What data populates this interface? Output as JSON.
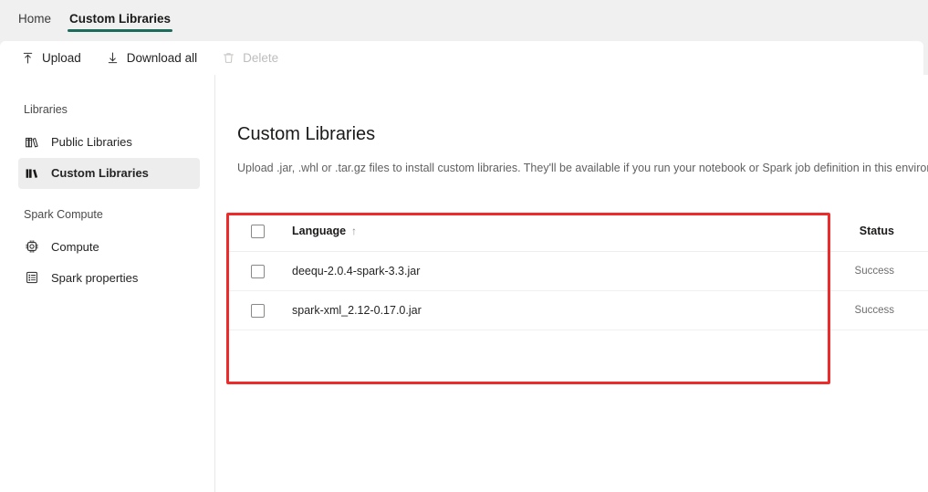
{
  "tabs": [
    {
      "label": "Home",
      "active": false
    },
    {
      "label": "Custom Libraries",
      "active": true
    }
  ],
  "toolbar": {
    "upload_label": "Upload",
    "upload_icon": "upload-arrow-icon",
    "download_all_label": "Download all",
    "download_all_icon": "download-arrow-icon",
    "delete_label": "Delete",
    "delete_icon": "trash-icon",
    "delete_disabled": true
  },
  "sidebar": {
    "groups": [
      {
        "title": "Libraries",
        "items": [
          {
            "label": "Public Libraries",
            "icon": "books-outline-icon",
            "selected": false
          },
          {
            "label": "Custom Libraries",
            "icon": "books-filled-icon",
            "selected": true
          }
        ]
      },
      {
        "title": "Spark Compute",
        "items": [
          {
            "label": "Compute",
            "icon": "cpu-chip-icon",
            "selected": false
          },
          {
            "label": "Spark properties",
            "icon": "list-document-icon",
            "selected": false
          }
        ]
      }
    ]
  },
  "main": {
    "title": "Custom Libraries",
    "description": "Upload .jar, .whl or .tar.gz files to install custom libraries. They'll be available if you run your notebook or Spark job definition in this environmen"
  },
  "table": {
    "select_all_checkbox": "unchecked",
    "columns": {
      "language": "Language",
      "sort_indicator": "↑",
      "status": "Status"
    },
    "rows": [
      {
        "checked": false,
        "language": "deequ-2.0.4-spark-3.3.jar",
        "status": "Success"
      },
      {
        "checked": false,
        "language": "spark-xml_2.12-0.17.0.jar",
        "status": "Success"
      }
    ]
  },
  "annotation": {
    "type": "highlight-rectangle",
    "color": "#ee2b2b"
  },
  "colors": {
    "tab_accent": "#1d6b5a",
    "chrome_background": "#f0f0f0",
    "selected_nav_background": "#ededed",
    "annotation_red": "#ee2b2b"
  }
}
